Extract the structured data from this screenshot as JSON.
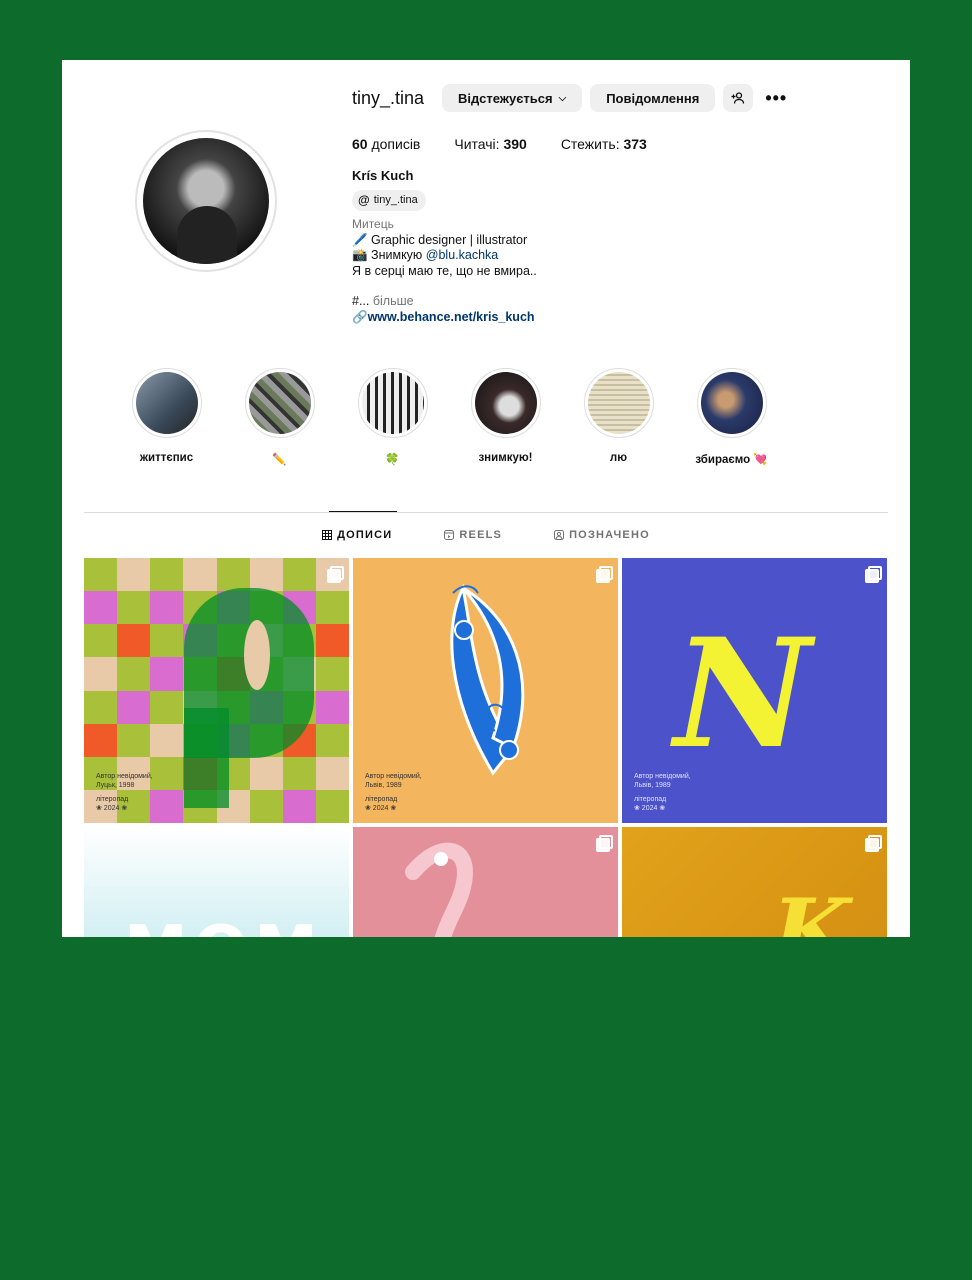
{
  "profile": {
    "username": "tiny_.tina",
    "follow_button": "Відстежується",
    "message_button": "Повідомлення",
    "add_person_icon": "+",
    "more_icon": "•••",
    "stats": {
      "posts_count": "60",
      "posts_label": "дописів",
      "followers_label": "Читачі:",
      "followers_count": "390",
      "following_label": "Стежить:",
      "following_count": "373"
    },
    "full_name": "Krís Kuch",
    "threads_handle": "tiny_.tina",
    "category": "Митець",
    "bio_line1": "🖊️ Graphic designer | illustrator",
    "bio_line2_prefix": "📸 Знимкую ",
    "bio_line2_mention": "@blu.kachka",
    "bio_line3": "Я в серці маю те, що не вмира..",
    "bio_more_prefix": "#... ",
    "bio_more": "більше",
    "link": "www.behance.net/kris_kuch"
  },
  "highlights": [
    {
      "label": "життєпис",
      "color": "#6a7a8a"
    },
    {
      "label": "✏️",
      "color": "#8a8a7a"
    },
    {
      "label": "🍀",
      "color": "#a0a0a0"
    },
    {
      "label": "знимкую!",
      "color": "#3a2a2a"
    },
    {
      "label": "лю",
      "color": "#d8d0b8"
    },
    {
      "label": "збираємо 💘",
      "color": "#2a3a6a"
    }
  ],
  "tabs": [
    {
      "label": "ДОПИСИ",
      "icon": "grid-icon",
      "active": true
    },
    {
      "label": "REELS",
      "icon": "reels-icon",
      "active": false
    },
    {
      "label": "ПОЗНАЧЕНО",
      "icon": "tagged-icon",
      "active": false
    }
  ],
  "posts": [
    {
      "caption1": "Автор невідомий,",
      "caption2": "Луцьк, 1998",
      "caption3": "літеропад",
      "caption4": "❀ 2024 ❀"
    },
    {
      "caption1": "Автор невідомий,",
      "caption2": "Львів, 1989",
      "caption3": "літеропад",
      "caption4": "❀ 2024 ❀"
    },
    {
      "caption1": "Автор невідомий,",
      "caption2": "Львів, 1989",
      "caption3": "літеропад",
      "caption4": "❀ 2024 ❀"
    }
  ],
  "post_letters": {
    "n": "N",
    "mom": "МОМ",
    "k": "K"
  }
}
